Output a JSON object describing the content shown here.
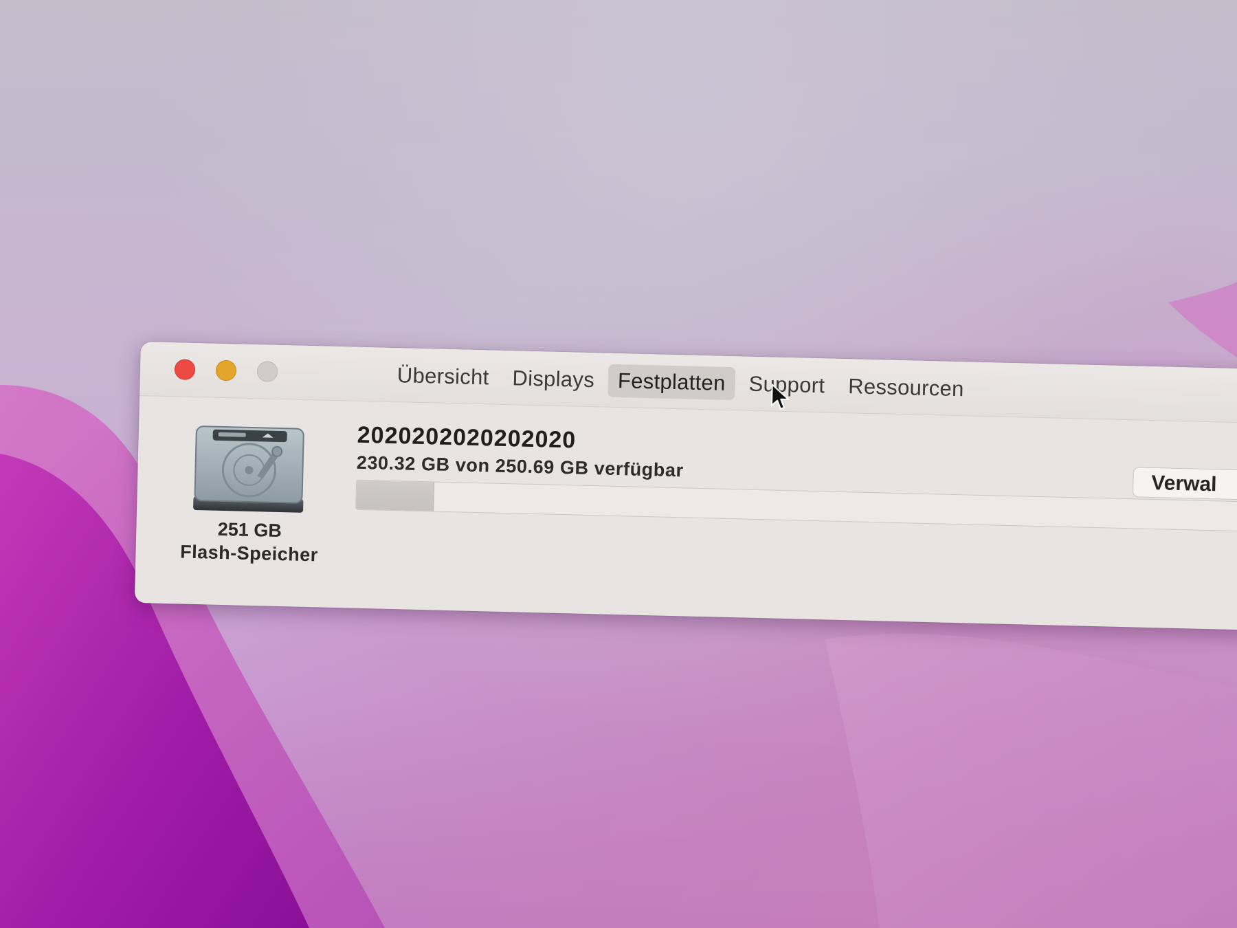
{
  "window": {
    "controls": [
      {
        "name": "close",
        "color": "#ec4b44"
      },
      {
        "name": "minimize",
        "color": "#e3a52b"
      },
      {
        "name": "zoom",
        "color": "#cfccc9"
      }
    ],
    "tabs": [
      {
        "label": "Übersicht",
        "active": false
      },
      {
        "label": "Displays",
        "active": false
      },
      {
        "label": "Festplatten",
        "active": true
      },
      {
        "label": "Support",
        "active": false
      },
      {
        "label": "Ressourcen",
        "active": false
      }
    ]
  },
  "disk": {
    "icon": "hard-drive-icon",
    "size": "251 GB",
    "type": "Flash-Speicher"
  },
  "volume": {
    "name": "2020202020202020",
    "usage_text": "230.32 GB von 250.69 GB verfügbar",
    "available_gb": 230.32,
    "total_gb": 250.69,
    "used_fraction": 0.08
  },
  "manage_button": {
    "label": "Verwal"
  },
  "cursor": {
    "icon": "mouse-pointer-icon"
  },
  "colors": {
    "desktop_magenta": "#a31fa8",
    "window_bg": "#e7e4e1"
  }
}
